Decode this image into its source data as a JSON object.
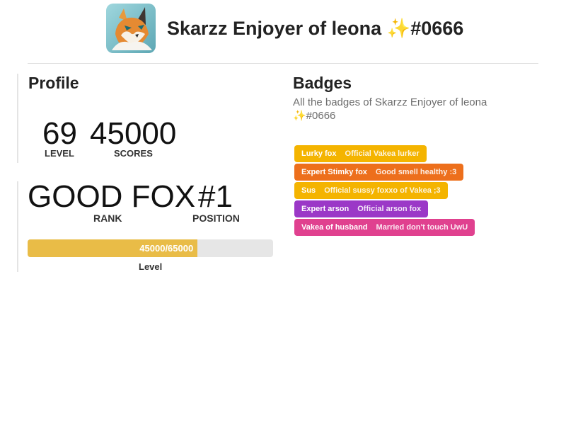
{
  "header": {
    "title": "Skarzz Enjoyer of leona ✨#0666",
    "avatar_icon": "fox-avatar-icon"
  },
  "profile": {
    "heading": "Profile",
    "level_value": "69",
    "level_label": "LEVEL",
    "score_value": "45000",
    "score_label": "SCORES"
  },
  "rank_block": {
    "rank_value": "GOOD FOX",
    "rank_label": "RANK",
    "position_value": "#1",
    "position_label": "POSITION",
    "progress_text": "45000/65000",
    "progress_fraction": 0.6923,
    "progress_label": "Level",
    "progress_color": "#e9bc47"
  },
  "badges": {
    "heading": "Badges",
    "description": "All the badges of Skarzz Enjoyer of leona ✨#0666",
    "items": [
      {
        "name": "Lurky fox",
        "description": "Official Vakea lurker",
        "color": "#f4b400"
      },
      {
        "name": "Expert Stimky fox",
        "description": "Good smell healthy :3",
        "color": "#ed6f1c"
      },
      {
        "name": "Sus",
        "description": "Official sussy foxxo of Vakea ;3",
        "color": "#f4b400"
      },
      {
        "name": "Expert arson",
        "description": "Official arson fox",
        "color": "#9b38c7"
      },
      {
        "name": "Vakea of husband",
        "description": "Married don't touch UwU",
        "color": "#e0418f"
      }
    ]
  }
}
